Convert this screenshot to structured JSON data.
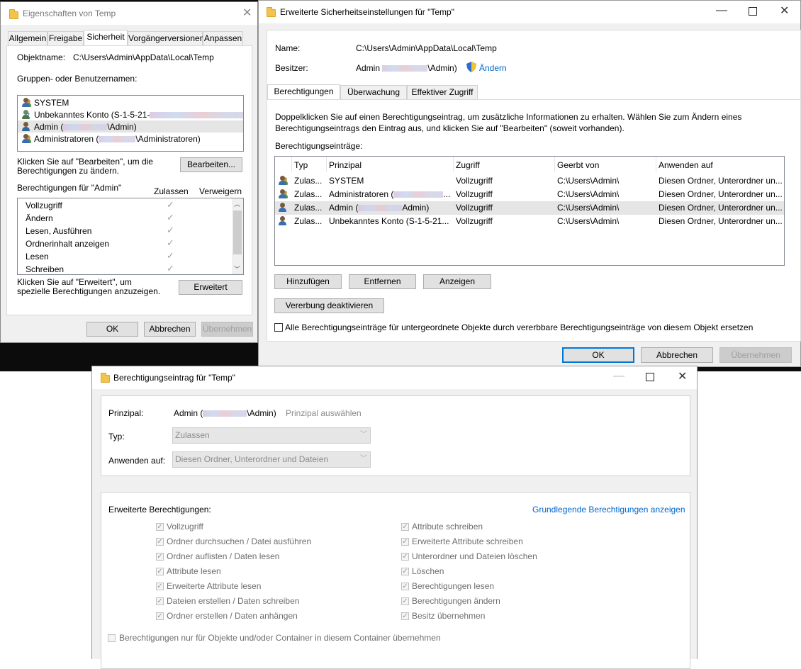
{
  "win1": {
    "title": "Eigenschaften von Temp",
    "tabs": [
      "Allgemein",
      "Freigabe",
      "Sicherheit",
      "Vorgängerversionen",
      "Anpassen"
    ],
    "objektname_label": "Objektname:",
    "objektname_value": "C:\\Users\\Admin\\AppData\\Local\\Temp",
    "groups_label": "Gruppen- oder Benutzernamen:",
    "users": [
      {
        "name": "SYSTEM",
        "suffix": ""
      },
      {
        "name": "Unbekanntes Konto (S-1-5-21-",
        "suffix": ""
      },
      {
        "name": "Admin (",
        "suffix": "\\Admin)"
      },
      {
        "name": "Administratoren (",
        "suffix": "\\Administratoren)"
      }
    ],
    "edit_hint": "Klicken Sie auf \"Bearbeiten\", um die Berechtigungen zu ändern.",
    "edit_button": "Bearbeiten...",
    "perm_for_label": "Berechtigungen für \"Admin\"",
    "col_allow": "Zulassen",
    "col_deny": "Verweigern",
    "perms": [
      "Vollzugriff",
      "Ändern",
      "Lesen, Ausführen",
      "Ordnerinhalt anzeigen",
      "Lesen",
      "Schreiben"
    ],
    "adv_hint": "Klicken Sie auf \"Erweitert\", um spezielle Berechtigungen anzuzeigen.",
    "adv_button": "Erweitert",
    "ok": "OK",
    "cancel": "Abbrechen",
    "apply": "Übernehmen"
  },
  "win2": {
    "title": "Erweiterte Sicherheitseinstellungen für \"Temp\"",
    "name_label": "Name:",
    "name_value": "C:\\Users\\Admin\\AppData\\Local\\Temp",
    "owner_label": "Besitzer:",
    "owner_value_prefix": "Admin",
    "owner_value_suffix": "\\Admin)",
    "change_link": "Ändern",
    "tabs": [
      "Berechtigungen",
      "Überwachung",
      "Effektiver Zugriff"
    ],
    "info": "Doppelklicken Sie auf einen Berechtigungseintrag, um zusätzliche Informationen zu erhalten. Wählen Sie zum Ändern eines Berechtigungseintrags den Eintrag aus, und klicken Sie auf \"Bearbeiten\" (soweit vorhanden).",
    "entries_label": "Berechtigungseinträge:",
    "columns": [
      "Typ",
      "Prinzipal",
      "Zugriff",
      "Geerbt von",
      "Anwenden auf"
    ],
    "rows": [
      {
        "typ": "Zulas...",
        "prinzipal": "SYSTEM",
        "zugriff": "Vollzugriff",
        "geerbt": "C:\\Users\\Admin\\",
        "anwenden": "Diesen Ordner, Unterordner un..."
      },
      {
        "typ": "Zulas...",
        "prinzipal": "Administratoren (",
        "zugriff": "Vollzugriff",
        "geerbt": "C:\\Users\\Admin\\",
        "anwenden": "Diesen Ordner, Unterordner un..."
      },
      {
        "typ": "Zulas...",
        "prinzipal": "Admin (",
        "zugriff": "Vollzugriff",
        "geerbt": "C:\\Users\\Admin\\",
        "anwenden": "Diesen Ordner, Unterordner un..."
      },
      {
        "typ": "Zulas...",
        "prinzipal": "Unbekanntes Konto (S-1-5-21...",
        "zugriff": "Vollzugriff",
        "geerbt": "C:\\Users\\Admin\\",
        "anwenden": "Diesen Ordner, Unterordner un..."
      }
    ],
    "row2_suffix": "...",
    "row3_suffix": "Admin)",
    "add": "Hinzufügen",
    "remove": "Entfernen",
    "view": "Anzeigen",
    "disable_inheritance": "Vererbung deaktivieren",
    "replace_checkbox": "Alle Berechtigungseinträge für untergeordnete Objekte durch vererbbare Berechtigungseinträge von diesem Objekt ersetzen",
    "ok": "OK",
    "cancel": "Abbrechen",
    "apply": "Übernehmen"
  },
  "win3": {
    "title": "Berechtigungseintrag für \"Temp\"",
    "principal_label": "Prinzipal:",
    "principal_value_prefix": "Admin (",
    "principal_value_suffix": "\\Admin)",
    "principal_select": "Prinzipal auswählen",
    "type_label": "Typ:",
    "type_value": "Zulassen",
    "apply_label": "Anwenden auf:",
    "apply_value": "Diesen Ordner, Unterordner und Dateien",
    "adv_label": "Erweiterte Berechtigungen:",
    "basic_link": "Grundlegende Berechtigungen anzeigen",
    "perms_left": [
      "Vollzugriff",
      "Ordner durchsuchen / Datei ausführen",
      "Ordner auflisten / Daten lesen",
      "Attribute lesen",
      "Erweiterte Attribute lesen",
      "Dateien erstellen / Daten schreiben",
      "Ordner erstellen / Daten anhängen"
    ],
    "perms_right": [
      "Attribute schreiben",
      "Erweiterte Attribute schreiben",
      "Unterordner und Dateien löschen",
      "Löschen",
      "Berechtigungen lesen",
      "Berechtigungen ändern",
      "Besitz übernehmen"
    ],
    "container_checkbox": "Berechtigungen nur für Objekte und/oder Container in diesem Container übernehmen"
  },
  "colors": {
    "accent": "#0078d7",
    "link": "#0066cc",
    "desktop": "#0c0c0c"
  },
  "icons": [
    "folder-icon",
    "user-icon",
    "group-icon",
    "shield-icon",
    "close-icon",
    "maximize-icon",
    "minimize-icon",
    "checkmark-icon",
    "scroll-up-icon",
    "scroll-down-icon",
    "dropdown-chevron-icon"
  ]
}
